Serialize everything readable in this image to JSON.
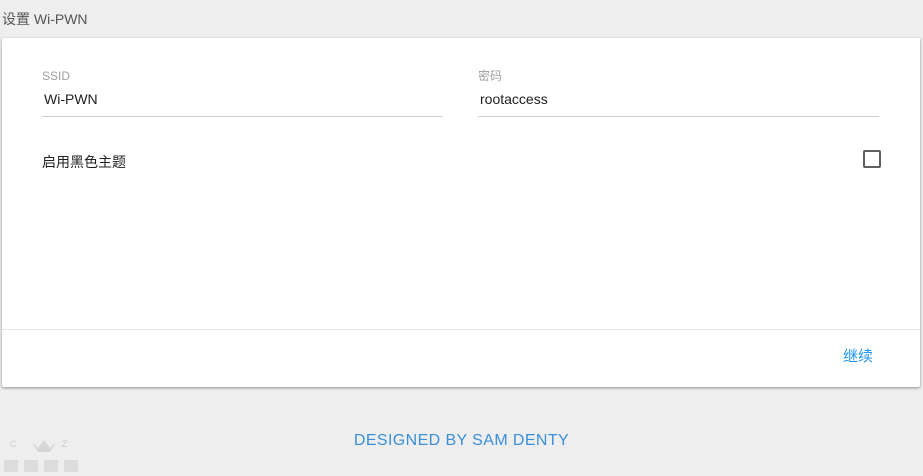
{
  "page": {
    "title": "设置 Wi-PWN"
  },
  "form": {
    "ssid": {
      "label": "SSID",
      "value": "Wi-PWN"
    },
    "password": {
      "label": "密码",
      "value": "rootaccess"
    },
    "dark_theme": {
      "label": "启用黑色主题",
      "checked": false
    }
  },
  "actions": {
    "continue_label": "继续"
  },
  "footer": {
    "credit": "DESIGNED BY SAM DENTY"
  },
  "colors": {
    "accent": "#2196f3",
    "background": "#eeeeee",
    "card": "#ffffff"
  }
}
